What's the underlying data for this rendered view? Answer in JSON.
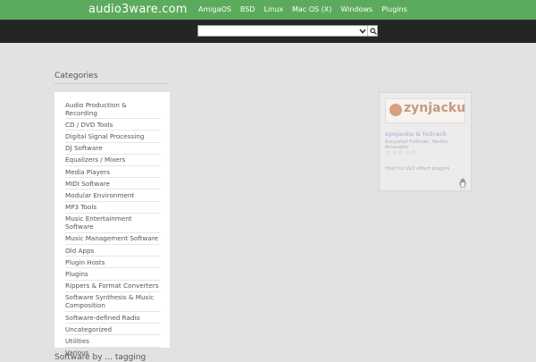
{
  "header": {
    "brand": "audio3ware.com",
    "nav": [
      "AmigaOS",
      "BSD",
      "Linux",
      "Mac OS (X)",
      "Windows",
      "Plugins"
    ]
  },
  "search": {
    "placeholder": "",
    "value": ""
  },
  "sidebar": {
    "title": "Categories",
    "items": [
      "Audio Production & Recording",
      "CD / DVD Tools",
      "Digital Signal Processing",
      "DJ Software",
      "Equalizers / Mixers",
      "Media Players",
      "MIDI Software",
      "Modular Environment",
      "MP3 Tools",
      "Music Entertainment Software",
      "Music Management Software",
      "Old Apps",
      "Plugin Hosts",
      "Plugins",
      "Rippers & Format Converters",
      "Software Synthesis & Music Composition",
      "Software-defined Radio",
      "Uncategorized",
      "Utilities",
      "Various"
    ],
    "next_section_title": "Software by ... tagging"
  },
  "card": {
    "logo_text": "zynjacku",
    "title": "zynjacku & lv2rack",
    "author": "Krzysztof Foltman, Nedko Arnaudov",
    "rating": "☆☆☆☆☆",
    "description": "Host for LV2 effect plugins",
    "platform_icon": "linux-tux-icon"
  }
}
